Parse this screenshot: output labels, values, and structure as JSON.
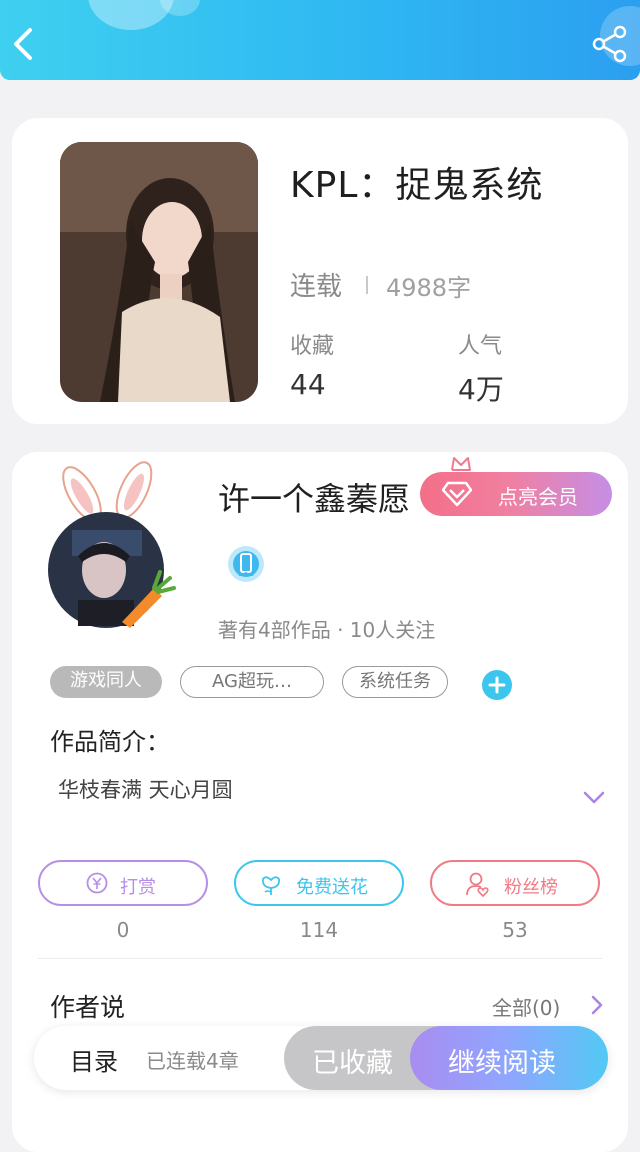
{
  "header": {
    "back_icon": "chevron-left-icon",
    "share_icon": "share-icon"
  },
  "book": {
    "title": "KPL：捉鬼系统",
    "status": "连载",
    "word_count": "4988字",
    "collect_label": "收藏",
    "collect_value": "44",
    "popularity_label": "人气",
    "popularity_value": "4万"
  },
  "author": {
    "name": "许一个鑫蓁愿",
    "vip_label": "点亮会员",
    "meta": "著有4部作品 · 10人关注",
    "tags": [
      "游戏同人",
      "AG超玩…",
      "系统任务"
    ]
  },
  "intro": {
    "label": "作品简介：",
    "text": "华枝春满 天心月圆"
  },
  "actions": [
    {
      "label": "打赏",
      "count": "0",
      "color": "#b68ee6"
    },
    {
      "label": "免费送花",
      "count": "114",
      "color": "#3cc6ee"
    },
    {
      "label": "粉丝榜",
      "count": "53",
      "color": "#ef7b85"
    }
  ],
  "author_says": {
    "label": "作者说",
    "all_label": "全部(0)"
  },
  "bottom": {
    "toc_label": "目录",
    "toc_sub": "已连载4章",
    "collected_label": "已收藏",
    "read_label": "继续阅读"
  }
}
